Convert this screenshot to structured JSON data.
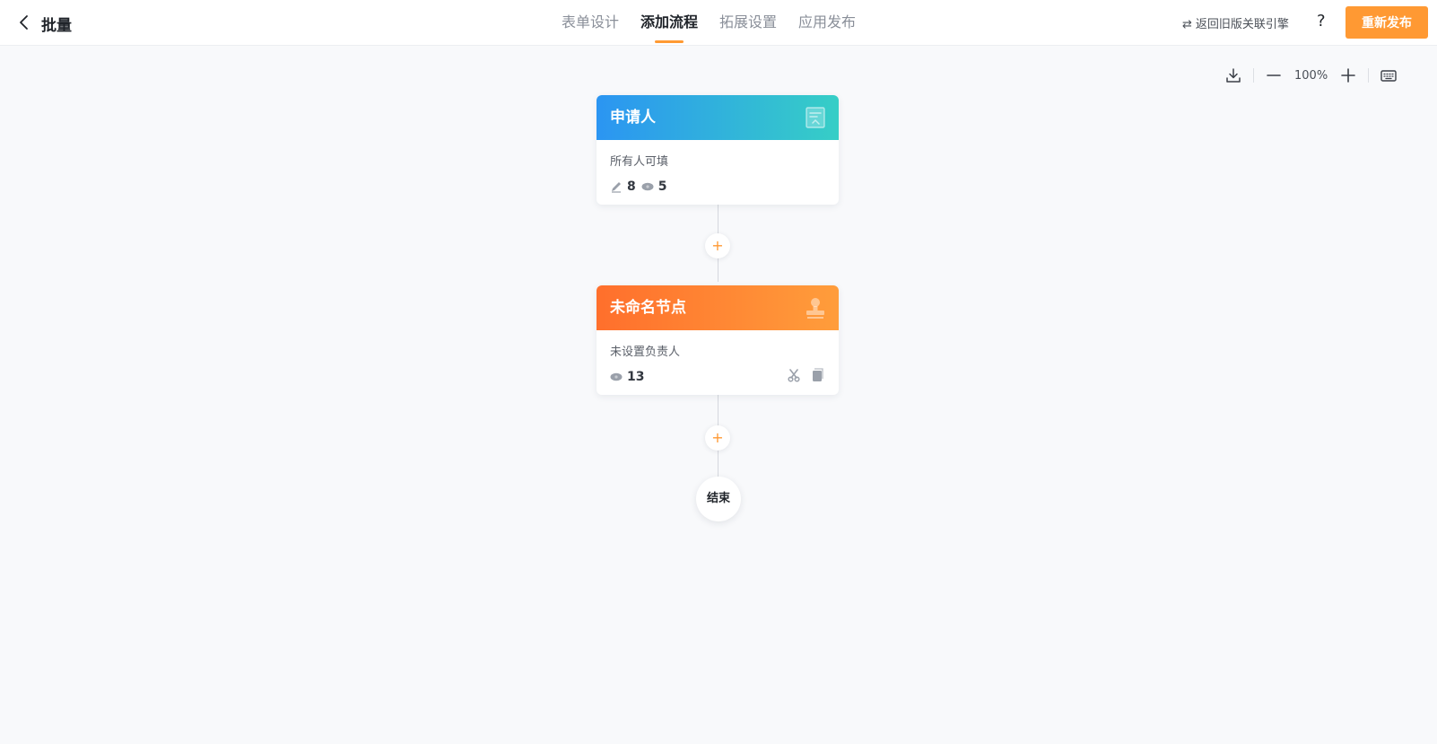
{
  "header": {
    "app_name": "批量",
    "tabs": [
      {
        "label": "表单设计"
      },
      {
        "label": "添加流程"
      },
      {
        "label": "拓展设置"
      },
      {
        "label": "应用发布"
      }
    ],
    "active_tab": "添加流程",
    "switch_icon": "⇄",
    "switch_label": "返回旧版关联引擎",
    "help_label": "?",
    "publish_label": "重新发布",
    "accent_color": "#ff9933"
  },
  "toolbar": {
    "zoom_label": "100%",
    "icons": [
      "download-icon",
      "zoom-out-icon",
      "zoom-in-icon",
      "keyboard-icon"
    ]
  },
  "flow": {
    "nodes": [
      {
        "title": "申请人",
        "desc": "所有人可填",
        "edit_count": "8",
        "view_count": "5",
        "color_start": "#2b95f2",
        "color_end": "#36cec6",
        "icon": "form-icon"
      },
      {
        "title": "未命名节点",
        "desc": "未设置负责人",
        "view_count": "13",
        "color_start": "#ff6f2c",
        "color_end": "#ff9d3b",
        "icon": "stamp-icon",
        "action_icons": [
          "cut-icon",
          "copy-icon"
        ]
      }
    ],
    "add_label": "+",
    "end_label": "结束"
  }
}
